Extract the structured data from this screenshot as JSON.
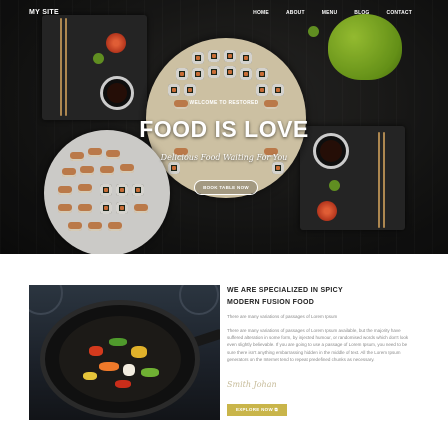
{
  "nav": {
    "logo": "MY SITE",
    "links": [
      "HOME",
      "ABOUT",
      "MENU",
      "BLOG",
      "CONTACT"
    ]
  },
  "hero": {
    "welcome": "WELCOME TO RESTORED",
    "headline": "FOOD IS LOVE",
    "tagline": "Delicious Food Waiting For You",
    "cta": "BOOK TABLE NOW"
  },
  "about": {
    "heading_line1": "WE ARE SPECIALIZED IN SPICY",
    "heading_line2": "MODERN FUSION FOOD",
    "lead": "There are many variations of passages of Lorem Ipsum",
    "body": "There are many variations of passages of Lorem Ipsum available, but the majority have suffered alteration in some form, by injected humour, or randomised words which don't look even slightly believable. If you are going to use a passage of Lorem Ipsum, you need to be sure there isn't anything embarrassing hidden in the middle of text. All the Lorem Ipsum generators on the Internet tend to repeat predefined chunks as necessary.",
    "signature": "Smith Johan",
    "cta": "EXPLORE NOW ⧉"
  },
  "colors": {
    "accent": "#c9b54a",
    "hero_bg": "#161615",
    "heading": "#222222",
    "body_text": "#8a8a8a"
  }
}
